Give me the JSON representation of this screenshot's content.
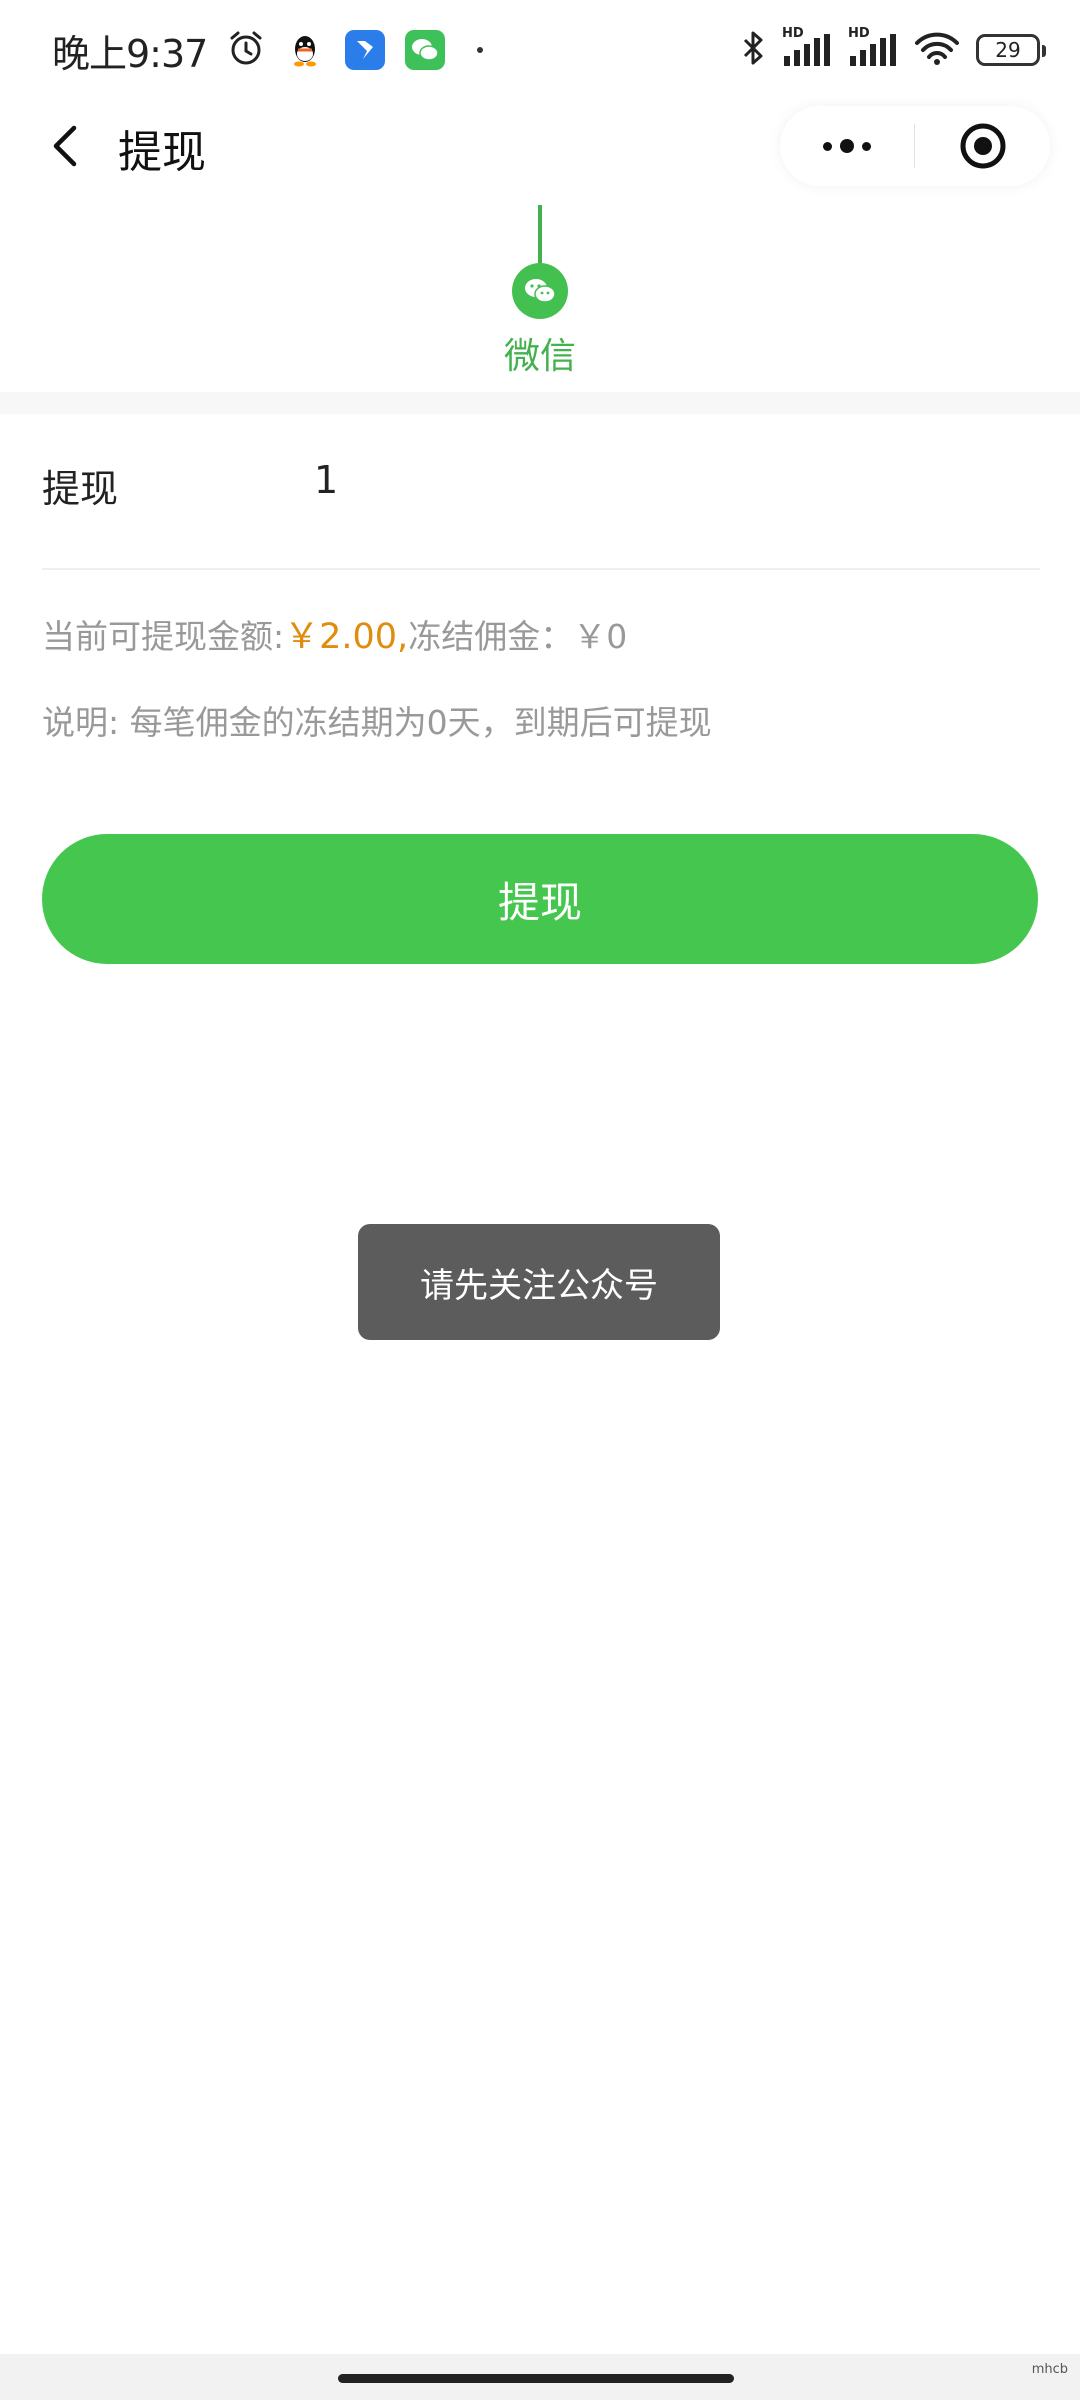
{
  "status_bar": {
    "time": "晚上9:37",
    "hd_1": "HD",
    "hd_2": "HD",
    "battery": "29",
    "icons": [
      "alarm-icon",
      "qq-icon",
      "lark-icon",
      "wechat-icon",
      "dot-icon",
      "bluetooth-icon",
      "signal-icon",
      "signal-icon",
      "wifi-icon",
      "battery-icon"
    ]
  },
  "nav": {
    "title": "提现",
    "back_icon": "chevron-left-icon",
    "more_icon": "more-dots-icon",
    "close_icon": "target-circle-icon"
  },
  "method": {
    "label": "微信",
    "icon": "wechat-icon"
  },
  "form": {
    "amount_label": "提现",
    "amount_value": "1"
  },
  "info": {
    "available_prefix": "当前可提现金额:",
    "available_amount": "￥2.00,",
    "frozen_text": "冻结佣金：￥0",
    "note": "说明: 每笔佣金的冻结期为0天，到期后可提现"
  },
  "submit_label": "提现",
  "toast": "请先关注公众号",
  "watermark": "mhcb",
  "colors": {
    "brand_green": "#45c74f",
    "money_orange": "#e08c0e",
    "muted_text": "#999999",
    "toast_bg": "#5c5c5c"
  }
}
